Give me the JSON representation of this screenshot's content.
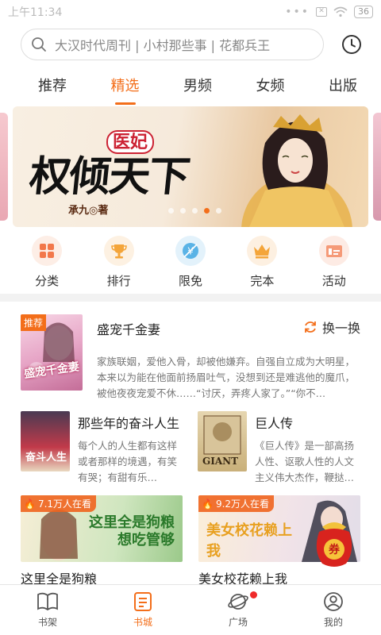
{
  "status": {
    "time": "上午11:34",
    "battery": "36"
  },
  "search": {
    "placeholder": "大汉时代周刊 | 小村那些事 | 花都兵王"
  },
  "tabs": [
    {
      "label": "推荐"
    },
    {
      "label": "精选"
    },
    {
      "label": "男频"
    },
    {
      "label": "女频"
    },
    {
      "label": "出版"
    }
  ],
  "active_tab": "精选",
  "banner": {
    "tag": "医妃",
    "title": "权倾天下",
    "author": "承九◎著"
  },
  "entries": [
    {
      "label": "分类",
      "icon": "grid-icon"
    },
    {
      "label": "排行",
      "icon": "trophy-icon"
    },
    {
      "label": "限免",
      "icon": "free-icon"
    },
    {
      "label": "完本",
      "icon": "crown-icon"
    },
    {
      "label": "活动",
      "icon": "activity-icon"
    }
  ],
  "recommend": {
    "tag": "推荐",
    "swap": "换一换",
    "main": {
      "title": "盛宠千金妻",
      "cover_title": "盛宠千金妻",
      "desc": "家族联姻，爱他入骨，却被他嫌弃。自强自立成为大明星，本来以为能在他面前扬眉吐气，没想到还是难逃他的魔爪，被他夜夜宠爱不休……“讨厌，弄疼人家了。”“你不…"
    },
    "mini": [
      {
        "title": "那些年的奋斗人生",
        "cover_title": "奋斗人生",
        "desc": "每个人的人生都有这样或者那样的境遇，有笑有哭；有甜有乐…"
      },
      {
        "title": "巨人传",
        "cover_title": "GIANT",
        "desc": "《巨人传》是一部高扬人性、讴歌人性的人文主义伟大杰作，鞭挞…"
      }
    ],
    "cards": [
      {
        "title": "这里全是狗粮",
        "badge": "7.1万人在看",
        "art": "这里全是狗粮 想吃管够"
      },
      {
        "title": "美女校花赖上我",
        "badge": "9.2万人在看",
        "art": "美女校花赖上我"
      }
    ]
  },
  "gift": {
    "label": "券"
  },
  "bottom_nav": [
    {
      "label": "书架",
      "icon": "book-icon"
    },
    {
      "label": "书城",
      "icon": "store-icon"
    },
    {
      "label": "广场",
      "icon": "planet-icon"
    },
    {
      "label": "我的",
      "icon": "user-icon"
    }
  ],
  "colors": {
    "accent": "#f36e1a",
    "badge_red": "#ef2a2a"
  }
}
